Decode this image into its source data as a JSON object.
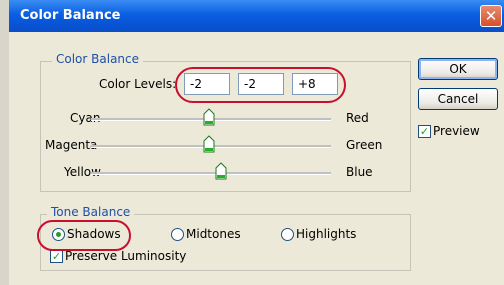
{
  "dialog": {
    "title": "Color Balance",
    "close_glyph": "✕"
  },
  "color_balance": {
    "group_label": "Color Balance",
    "levels_label": "Color Levels:",
    "levels": [
      "-2",
      "-2",
      "+8"
    ],
    "sliders": [
      {
        "left": "Cyan",
        "right": "Red",
        "value": -2
      },
      {
        "left": "Magenta",
        "right": "Green",
        "value": -2
      },
      {
        "left": "Yellow",
        "right": "Blue",
        "value": 8
      }
    ],
    "slider_range": [
      -100,
      100
    ]
  },
  "buttons": {
    "ok": "OK",
    "cancel": "Cancel"
  },
  "preview": {
    "label": "Preview",
    "checked": true
  },
  "tone_balance": {
    "group_label": "Tone Balance",
    "options": [
      "Shadows",
      "Midtones",
      "Highlights"
    ],
    "selected": "Shadows",
    "preserve_label": "Preserve Luminosity",
    "preserve_checked": true
  },
  "icons": {
    "close": "close-icon",
    "slider_thumb": "slider-thumb-icon",
    "checkmark": "checkmark-icon"
  },
  "colors": {
    "title_bar": "#0a5fe0",
    "dialog_bg": "#ece9d8",
    "group_label": "#1f4fa6",
    "annotation": "#c8102e",
    "check": "#21a121"
  }
}
